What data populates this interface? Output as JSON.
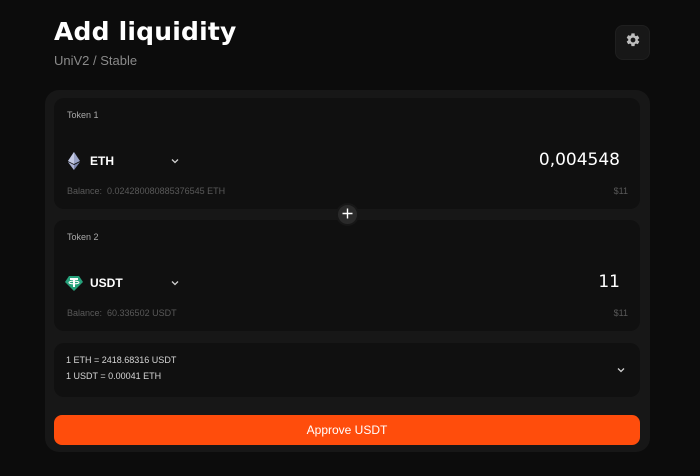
{
  "header": {
    "title": "Add liquidity",
    "subtitle": "UniV2 / Stable",
    "settings_icon": "gear-icon"
  },
  "token1": {
    "label": "Token 1",
    "symbol": "ETH",
    "icon": "ethereum-icon",
    "amount": "0,004548",
    "balance_label": "Balance:",
    "balance_value": "0.024280080885376545 ETH",
    "usd_value": "$11"
  },
  "plus_icon": "plus-icon",
  "token2": {
    "label": "Token 2",
    "symbol": "USDT",
    "icon": "tether-icon",
    "amount": "11",
    "balance_label": "Balance:",
    "balance_value": "60.336502 USDT",
    "usd_value": "$11"
  },
  "rates": {
    "line1": "1 ETH = 2418.68316 USDT",
    "line2": "1 USDT = 0.00041 ETH",
    "toggle_icon": "chevron-down-icon"
  },
  "approve": {
    "label": "Approve USDT"
  },
  "colors": {
    "background": "#0c0c0c",
    "panel": "#171717",
    "card": "#101010",
    "accent": "#ff4d0c",
    "tether": "#26a17b"
  }
}
